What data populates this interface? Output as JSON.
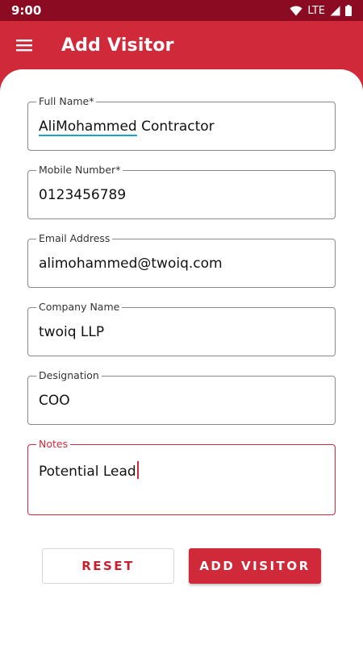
{
  "status_bar": {
    "time": "9:00",
    "network": "LTE",
    "icons": [
      "wifi-icon",
      "signal-icon",
      "battery-icon"
    ]
  },
  "app_bar": {
    "title": "Add Visitor",
    "menu_icon": "hamburger-menu-icon"
  },
  "form": {
    "full_name": {
      "label": "Full Name*",
      "value_underlined": "AliMohammed",
      "value_rest": " Contractor"
    },
    "mobile": {
      "label": "Mobile Number*",
      "value": "0123456789"
    },
    "email": {
      "label": "Email Address",
      "value": "alimohammed@twoiq.com"
    },
    "company": {
      "label": "Company Name",
      "value": "twoiq LLP"
    },
    "designation": {
      "label": "Designation",
      "value": "COO"
    },
    "notes": {
      "label": "Notes",
      "value": "Potential Lead"
    }
  },
  "buttons": {
    "reset": "RESET",
    "add_visitor": "ADD VISITOR"
  },
  "colors": {
    "primary": "#d0293a",
    "status_bar": "#8b0b22",
    "focus_underline": "#1aa3c8"
  }
}
